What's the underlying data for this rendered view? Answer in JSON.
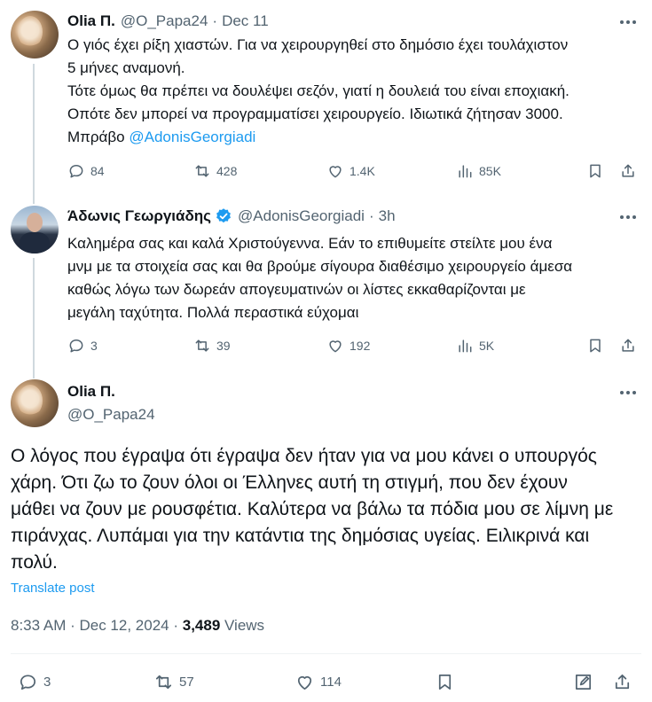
{
  "tweet1": {
    "name": "Olia Π.",
    "handle": "@O_Papa24",
    "time": "Dec 11",
    "lines": [
      "Ο γιός έχει ρίξη χιαστών. Για να χειρουργηθεί στο δημόσιο έχει τουλάχιστον",
      "5 μήνες αναμονή.",
      "Τότε όμως θα πρέπει να δουλέψει σεζόν, γιατί η δουλειά του είναι εποχιακή.",
      "Οπότε δεν μπορεί να προγραμματίσει χειρουργείο. Ιδιωτικά ζήτησαν 3000.",
      "Μπράβο"
    ],
    "mention": "@AdonisGeorgiadi",
    "replies": "84",
    "reposts": "428",
    "likes": "1.4K",
    "views": "85K"
  },
  "tweet2": {
    "name": "Άδωνις Γεωργιάδης",
    "handle": "@AdonisGeorgiadi",
    "time": "3h",
    "lines": [
      "Καλημέρα σας και καλά Χριστούγεννα. Εάν το επιθυμείτε στείλτε μου ένα",
      "μνμ με τα στοιχεία σας και θα βρούμε σίγουρα διαθέσιμο χειρουργείο άμεσα",
      "καθώς λόγω των δωρεάν απογευματινών οι λίστες εκκαθαρίζονται με",
      "μεγάλη ταχύτητα. Πολλά περαστικά εύχομαι"
    ],
    "replies": "3",
    "reposts": "39",
    "likes": "192",
    "views": "5K"
  },
  "main": {
    "name": "Olia Π.",
    "handle": "@O_Papa24",
    "lines": [
      "Ο λόγος που έγραψα ότι έγραψα δεν ήταν για να μου κάνει ο υπουργός",
      "χάρη. Ότι ζω το ζουν όλοι οι Έλληνες αυτή τη στιγμή, που δεν έχουν",
      "μάθει να ζουν με ρουσφέτια. Καλύτερα να βάλω τα πόδια μου σε λίμνη με",
      "πιράνχας. Λυπάμαι για την κατάντια της δημόσιας υγείας. Ειλικρινά και",
      "πολύ."
    ],
    "translate": "Translate post",
    "timestamp": "8:33 AM · Dec 12, 2024 ·",
    "views_count": "3,489",
    "views_label": "Views",
    "replies": "3",
    "reposts": "57",
    "likes": "114"
  },
  "colors": {
    "accent": "#1d9bf0",
    "text": "#0f1419",
    "muted": "#536471",
    "line": "#cfd9de"
  }
}
